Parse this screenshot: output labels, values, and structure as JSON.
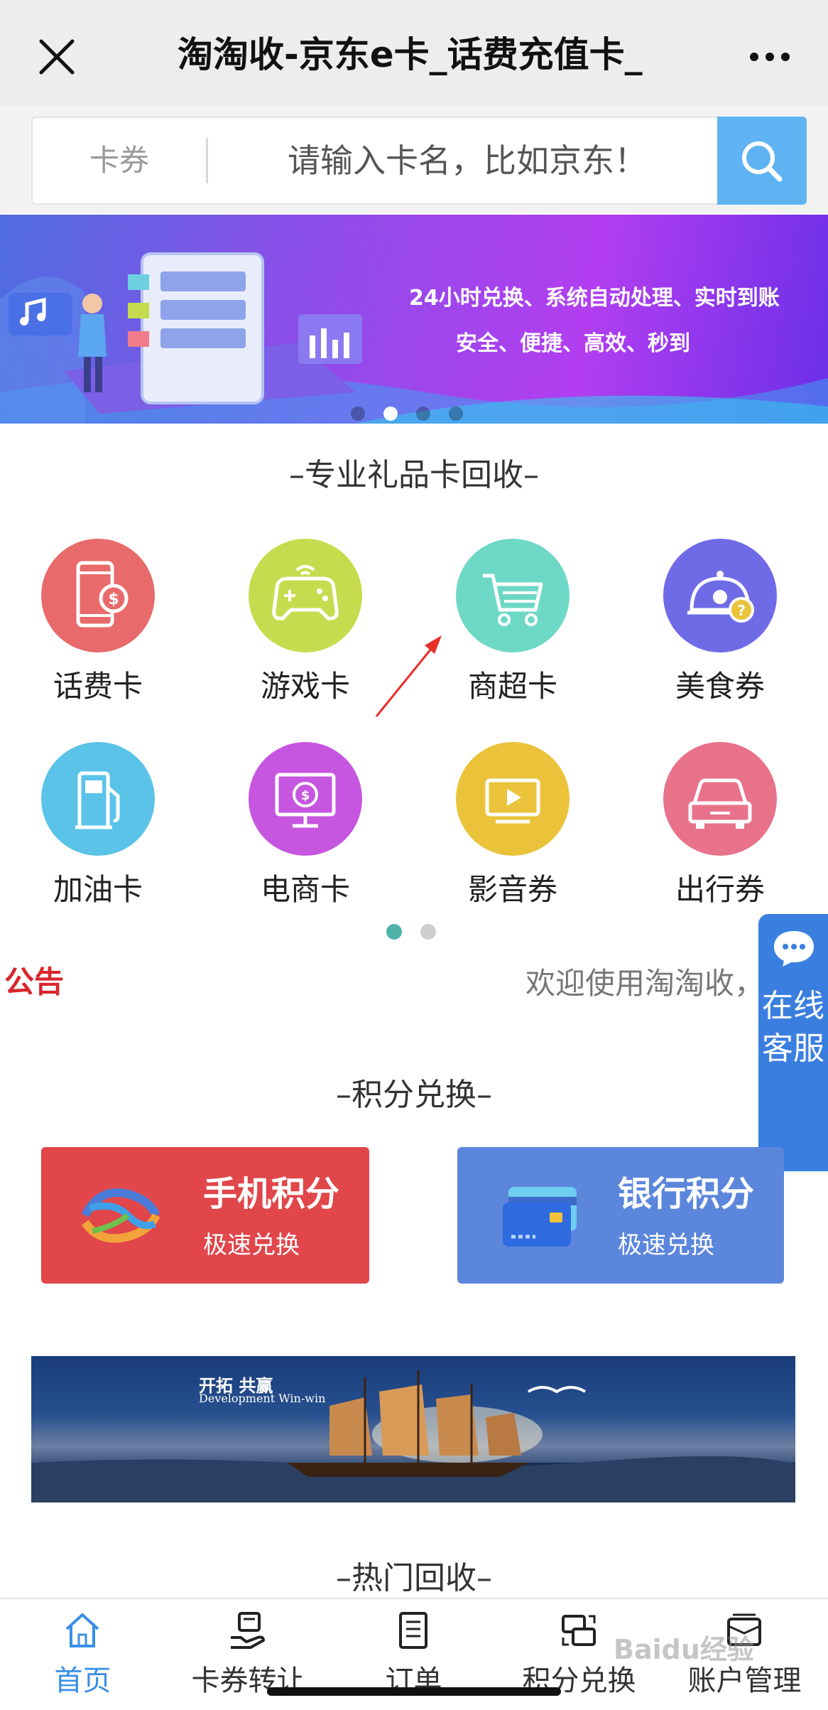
{
  "window": {
    "title": "淘淘收-京东e卡_话费充值卡_",
    "close_icon": "close-icon",
    "more_icon": "more-icon"
  },
  "search": {
    "category": "卡券",
    "placeholder": "请输入卡名，比如京东！",
    "button_icon": "search-icon"
  },
  "banner": {
    "line1": "24小时兑换、系统自动处理、实时到账",
    "line2": "安全、便捷、高效、秒到",
    "slides": 4,
    "active_slide": 2
  },
  "gift_section": {
    "title": "–专业礼品卡回收–",
    "categories": [
      {
        "label": "话费卡",
        "icon": "phone-card-icon",
        "color": "#e86a6a"
      },
      {
        "label": "游戏卡",
        "icon": "gamepad-icon",
        "color": "#c6dc4e"
      },
      {
        "label": "商超卡",
        "icon": "shopping-cart-icon",
        "color": "#6ed8c6"
      },
      {
        "label": "美食券",
        "icon": "food-cloche-icon",
        "color": "#6f6be6"
      },
      {
        "label": "加油卡",
        "icon": "fuel-pump-icon",
        "color": "#5bc3e8"
      },
      {
        "label": "电商卡",
        "icon": "ecommerce-monitor-icon",
        "color": "#c655e0"
      },
      {
        "label": "影音券",
        "icon": "video-play-icon",
        "color": "#eac33a"
      },
      {
        "label": "出行券",
        "icon": "car-icon",
        "color": "#e8728a"
      }
    ],
    "pages": 2,
    "active_page": 1
  },
  "notice": {
    "label": "公告",
    "text": "欢迎使用淘淘收，"
  },
  "float_service": {
    "icon": "chat-bubble-icon",
    "text": "在线客服"
  },
  "points_section": {
    "title": "–积分兑换–",
    "cards": [
      {
        "title": "手机积分",
        "subtitle": "极速兑换",
        "icon": "china-mobile-logo",
        "color": "#e0464a"
      },
      {
        "title": "银行积分",
        "subtitle": "极速兑换",
        "icon": "bank-card-icon",
        "color": "#5b86db"
      }
    ]
  },
  "promo": {
    "cn_text": "开拓 共赢",
    "en_text": "Development Win-win"
  },
  "hot_section": {
    "title": "–热门回收–"
  },
  "tabbar": {
    "tabs": [
      {
        "label": "首页",
        "icon": "home-icon",
        "active": true
      },
      {
        "label": "卡券转让",
        "icon": "card-transfer-icon",
        "active": false
      },
      {
        "label": "订单",
        "icon": "order-list-icon",
        "active": false
      },
      {
        "label": "积分兑换",
        "icon": "points-exchange-icon",
        "active": false
      },
      {
        "label": "账户管理",
        "icon": "wallet-icon",
        "active": false
      }
    ],
    "accent": "#3a8ee6"
  },
  "watermark": "Baidu经验"
}
